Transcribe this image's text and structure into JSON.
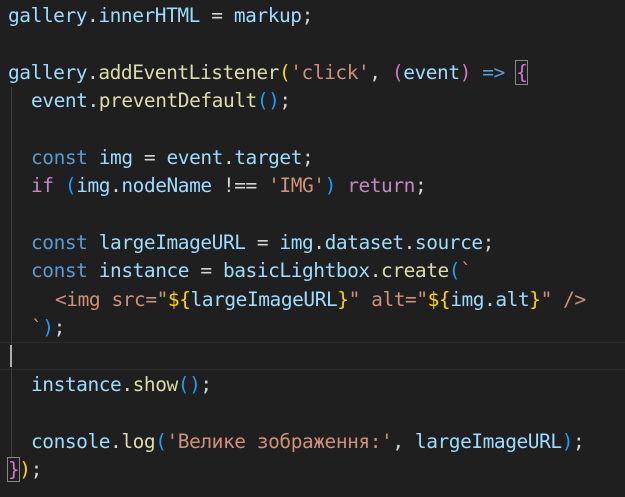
{
  "colors": {
    "background": "#1f1f1f",
    "variable": "#9cdcfe",
    "function": "#dcdcaa",
    "keyword": "#569cd6",
    "control": "#c586c0",
    "string": "#ce9178",
    "bracket_1": "#ffd700",
    "bracket_2": "#da70d6",
    "bracket_3": "#179fff"
  },
  "code": {
    "l1": {
      "a": "gallery",
      "b": ".",
      "c": "innerHTML",
      "d": " = ",
      "e": "markup",
      "f": ";"
    },
    "l3": {
      "a": "gallery",
      "b": ".",
      "c": "addEventListener",
      "d": "(",
      "e": "'click'",
      "f": ", ",
      "g": "(",
      "h": "event",
      "i": ")",
      "j": " => ",
      "k": "{"
    },
    "l4": {
      "a": "event",
      "b": ".",
      "c": "preventDefault",
      "d": "()",
      "e": ";"
    },
    "l6": {
      "a": "const",
      "b": " ",
      "c": "img",
      "d": " = ",
      "e": "event",
      "f": ".",
      "g": "target",
      "h": ";"
    },
    "l7": {
      "a": "if",
      "b": " ",
      "c": "(",
      "d": "img",
      "e": ".",
      "f": "nodeName",
      "g": " !== ",
      "h": "'IMG'",
      "i": ")",
      "j": " ",
      "k": "return",
      "l": ";"
    },
    "l9": {
      "a": "const",
      "b": " ",
      "c": "largeImageURL",
      "d": " = ",
      "e": "img",
      "f": ".",
      "g": "dataset",
      "h": ".",
      "i": "source",
      "j": ";"
    },
    "l10": {
      "a": "const",
      "b": " ",
      "c": "instance",
      "d": " = ",
      "e": "basicLightbox",
      "f": ".",
      "g": "create",
      "h": "(",
      "i": "`"
    },
    "l11": {
      "a": "<",
      "b": "img",
      "c": " src=\"",
      "d": "${",
      "e": "largeImageURL",
      "f": "}",
      "g": "\" alt=\"",
      "h": "${",
      "i": "img",
      "j": ".",
      "k": "alt",
      "l": "}",
      "m": "\" />"
    },
    "l12": {
      "a": "`",
      "b": ")",
      "c": ";"
    },
    "l14": {
      "a": "instance",
      "b": ".",
      "c": "show",
      "d": "()",
      "e": ";"
    },
    "l16": {
      "a": "console",
      "b": ".",
      "c": "log",
      "d": "(",
      "e": "'Велике зображення:'",
      "f": ", ",
      "g": "largeImageURL",
      "h": ")",
      "i": ";"
    },
    "l17": {
      "a": "}",
      "b": ")",
      "c": ";"
    }
  }
}
